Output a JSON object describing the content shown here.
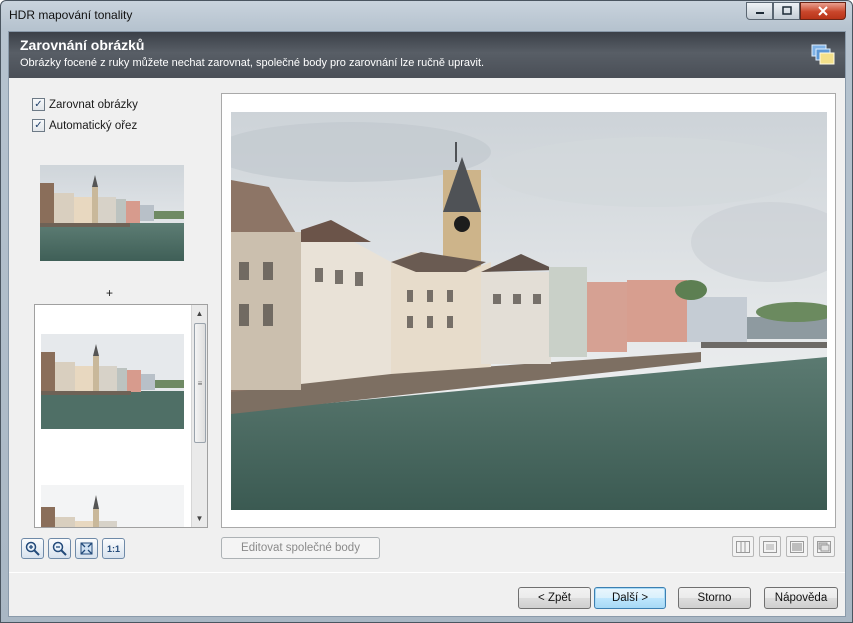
{
  "window": {
    "title": "HDR mapování tonality"
  },
  "header": {
    "title": "Zarovnání obrázků",
    "subtitle": "Obrázky focené z ruky můžete nechat zarovnat, společné body pro zarovnání lze ručně upravit."
  },
  "options": [
    {
      "label": "Zarovnat obrázky",
      "checked": true
    },
    {
      "label": "Automatický ořez",
      "checked": true
    }
  ],
  "plus_sign": "+",
  "zoom_toolbar": {
    "fixed_label": "1:1"
  },
  "edit_points_button": "Editovat společné body",
  "footer": {
    "back": "< Zpět",
    "next": "Další >",
    "cancel": "Storno",
    "help": "Nápověda"
  },
  "colors": {
    "header_bg": "#4a4f57",
    "water": "#4e6f66",
    "sky": "#e3e7ea",
    "accent": "#3c7fb1"
  }
}
